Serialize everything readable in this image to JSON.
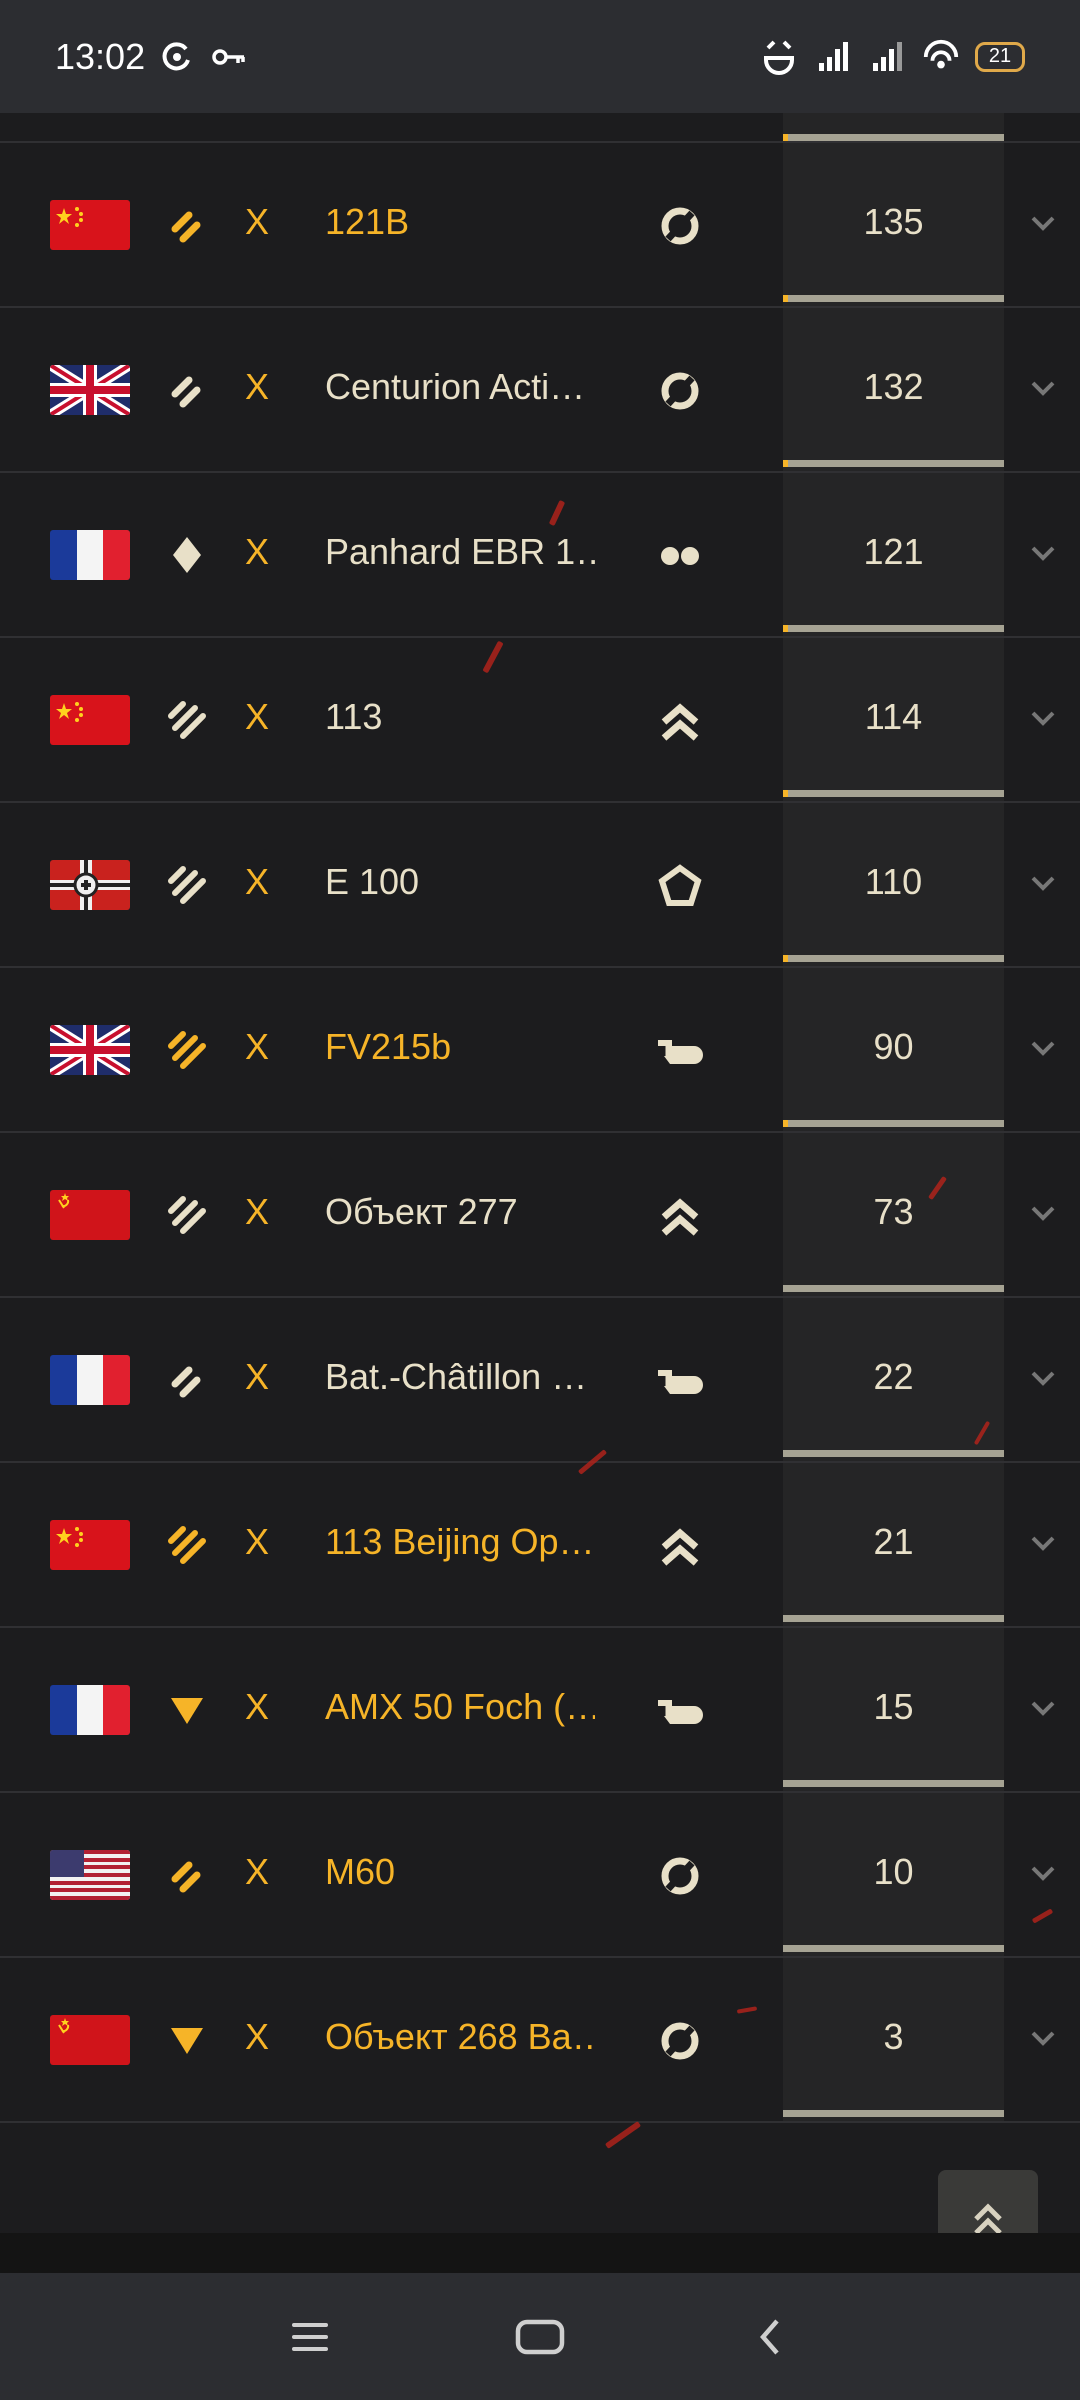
{
  "status_bar": {
    "time": "13:02",
    "battery": "21"
  },
  "colors": {
    "accent": "#f6b428",
    "text": "#e8e0c8",
    "background": "#1c1c1e"
  },
  "vehicles": [
    {
      "flag": "china",
      "rank_icon": "rank-two-chevron-icon",
      "rank_color": "gold",
      "tier": "X",
      "name": "121B",
      "name_color": "gold",
      "type_icon": "medium-tank-icon",
      "count": "135"
    },
    {
      "flag": "uk",
      "rank_icon": "rank-two-chevron-icon",
      "rank_color": "cream",
      "tier": "X",
      "name": "Centurion Acti…",
      "name_color": "cream",
      "type_icon": "medium-tank-icon",
      "count": "132"
    },
    {
      "flag": "france",
      "rank_icon": "rank-diamond-icon",
      "rank_color": "cream",
      "tier": "X",
      "name": "Panhard EBR 1…",
      "name_color": "cream",
      "type_icon": "wheeled-vehicle-icon",
      "count": "121"
    },
    {
      "flag": "china",
      "rank_icon": "rank-three-chevron-icon",
      "rank_color": "cream",
      "tier": "X",
      "name": "113",
      "name_color": "cream",
      "type_icon": "heavy-tank-icon",
      "count": "114"
    },
    {
      "flag": "germany",
      "rank_icon": "rank-three-chevron-icon",
      "rank_color": "cream",
      "tier": "X",
      "name": "E 100",
      "name_color": "cream",
      "type_icon": "superheavy-tank-icon",
      "count": "110"
    },
    {
      "flag": "uk",
      "rank_icon": "rank-three-chevron-icon",
      "rank_color": "gold",
      "tier": "X",
      "name": "FV215b",
      "name_color": "gold",
      "type_icon": "tank-destroyer-icon",
      "count": "90"
    },
    {
      "flag": "ussr",
      "rank_icon": "rank-three-chevron-icon",
      "rank_color": "cream",
      "tier": "X",
      "name": "Объект 277",
      "name_color": "cream",
      "type_icon": "heavy-tank-icon",
      "count": "73"
    },
    {
      "flag": "france",
      "rank_icon": "rank-two-chevron-icon",
      "rank_color": "cream",
      "tier": "X",
      "name": "Bat.-Châtillon …",
      "name_color": "cream",
      "type_icon": "tank-destroyer-icon",
      "count": "22"
    },
    {
      "flag": "china",
      "rank_icon": "rank-three-chevron-icon",
      "rank_color": "gold",
      "tier": "X",
      "name": "113 Beijing Op…",
      "name_color": "gold",
      "type_icon": "heavy-tank-icon",
      "count": "21"
    },
    {
      "flag": "france",
      "rank_icon": "rank-triangle-icon",
      "rank_color": "gold",
      "tier": "X",
      "name": "AMX 50 Foch (…",
      "name_color": "gold",
      "type_icon": "tank-destroyer-icon",
      "count": "15"
    },
    {
      "flag": "usa",
      "rank_icon": "rank-two-chevron-icon",
      "rank_color": "gold",
      "tier": "X",
      "name": "M60",
      "name_color": "gold",
      "type_icon": "medium-tank-icon",
      "count": "10"
    },
    {
      "flag": "ussr",
      "rank_icon": "rank-triangle-icon",
      "rank_color": "gold",
      "tier": "X",
      "name": "Объект 268 Ва…",
      "name_color": "gold",
      "type_icon": "medium-tank-icon",
      "count": "3"
    }
  ]
}
